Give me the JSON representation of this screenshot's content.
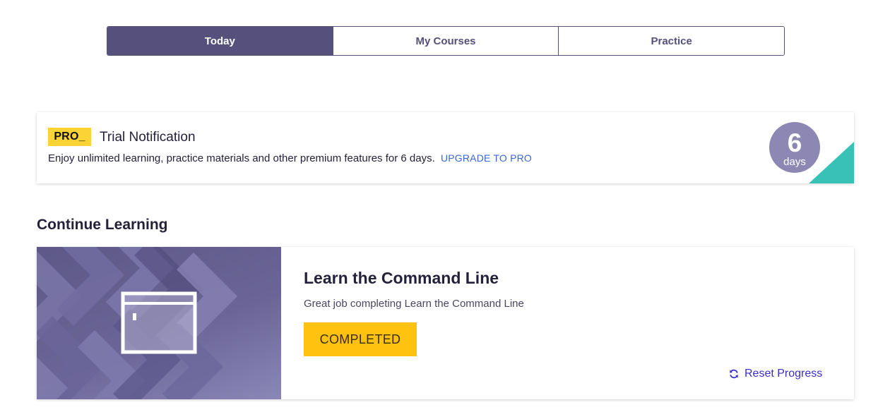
{
  "tabs": [
    {
      "label": "Today",
      "active": true
    },
    {
      "label": "My Courses",
      "active": false
    },
    {
      "label": "Practice",
      "active": false
    }
  ],
  "trial": {
    "badge": "PRO_",
    "title": "Trial Notification",
    "text": "Enjoy unlimited learning, practice materials and other premium features for 6 days.",
    "upgrade_link": "UPGRADE TO PRO",
    "days_count": "6",
    "days_label": "days"
  },
  "continue_learning": {
    "heading": "Continue Learning",
    "course": {
      "title": "Learn the Command Line",
      "subtitle": "Great job completing Learn the Command Line",
      "status_button": "COMPLETED",
      "reset_label": "Reset Progress",
      "art_icon": "browser-window-icon"
    }
  },
  "colors": {
    "primary": "#56507d",
    "pro_yellow": "#fcd335",
    "link_blue": "#3a66d8",
    "days_circle": "#8d87b3",
    "corner_teal": "#38c1b6",
    "completed_yellow": "#ffc20e",
    "reset_purple": "#3a2ec8"
  }
}
